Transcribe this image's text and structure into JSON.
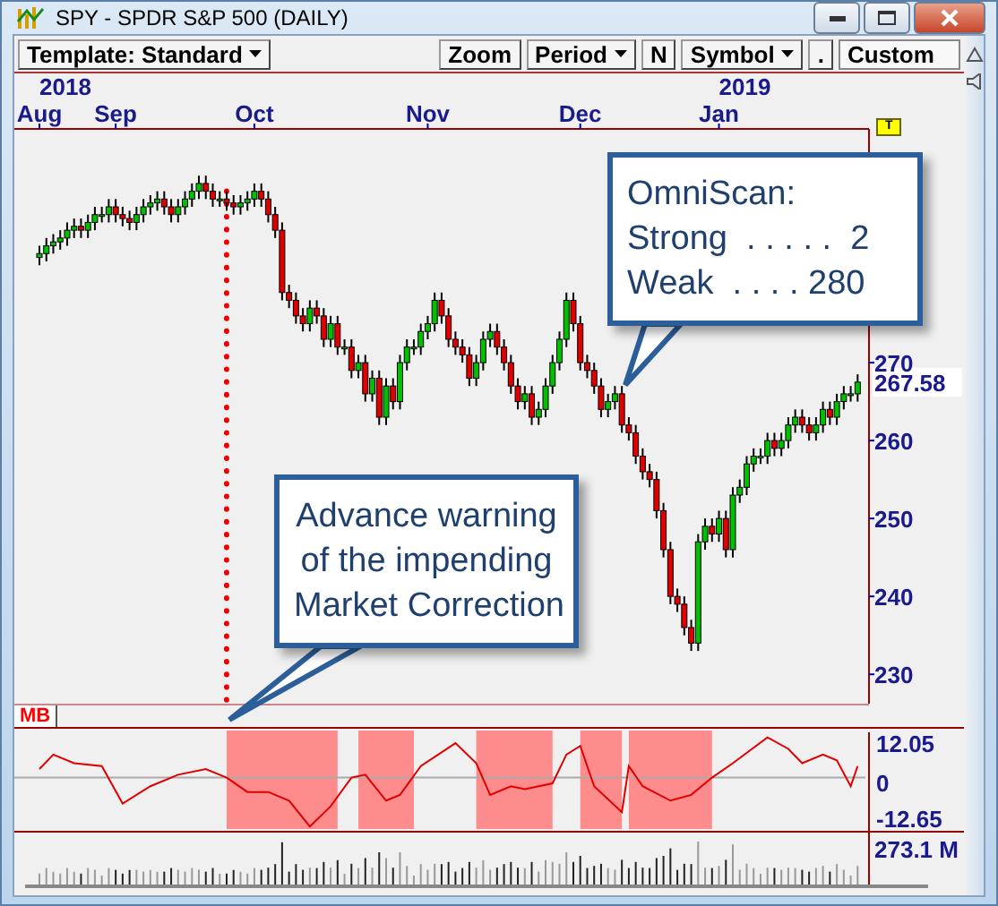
{
  "window": {
    "title": "SPY - SPDR S&P 500 (DAILY)"
  },
  "toolbar": {
    "template": "Template: Standard",
    "buttons": [
      {
        "label": "Zoom",
        "dropdown": false
      },
      {
        "label": "Period",
        "dropdown": true
      },
      {
        "label": "N",
        "dropdown": false
      },
      {
        "label": "Symbol",
        "dropdown": true
      },
      {
        "label": ".",
        "dropdown": false
      }
    ],
    "custom": "Custom"
  },
  "date_axis": {
    "years": [
      "2018",
      "2019"
    ]
  },
  "flag_label": "T",
  "price_chart": {
    "last_price": "267.58",
    "chart_data": {
      "type": "candlestick",
      "ylim": [
        226,
        300
      ],
      "yticks": [
        230,
        240,
        250,
        260,
        270
      ],
      "categories": [
        "Aug",
        null,
        null,
        null,
        null,
        null,
        null,
        null,
        null,
        null,
        null,
        "Sep",
        null,
        null,
        null,
        null,
        null,
        null,
        null,
        null,
        null,
        null,
        null,
        null,
        null,
        null,
        null,
        null,
        null,
        null,
        null,
        "Oct",
        null,
        null,
        null,
        null,
        null,
        null,
        null,
        null,
        null,
        null,
        null,
        null,
        null,
        null,
        null,
        null,
        null,
        null,
        null,
        null,
        null,
        null,
        null,
        null,
        "Nov",
        null,
        null,
        null,
        null,
        null,
        null,
        null,
        null,
        null,
        null,
        null,
        null,
        null,
        null,
        null,
        null,
        null,
        null,
        null,
        null,
        null,
        "Dec",
        null,
        null,
        null,
        null,
        null,
        null,
        null,
        null,
        null,
        null,
        null,
        null,
        null,
        null,
        null,
        null,
        null,
        null,
        null,
        "Jan",
        null,
        null,
        null,
        null,
        null,
        null,
        null,
        null,
        null,
        null,
        null,
        null,
        null,
        null,
        null,
        null,
        null,
        null,
        null,
        null
      ],
      "ohlc": [
        [
          283.5,
          285,
          282.5,
          284
        ],
        [
          284,
          286,
          283,
          285
        ],
        [
          285,
          286.5,
          284,
          285.5
        ],
        [
          285.5,
          287,
          284.5,
          286
        ],
        [
          286,
          288,
          285,
          287
        ],
        [
          287,
          288.5,
          286,
          287.5
        ],
        [
          287.5,
          288.5,
          286,
          287
        ],
        [
          287,
          289,
          286,
          288
        ],
        [
          288,
          290,
          287,
          289
        ],
        [
          289,
          290,
          288,
          289
        ],
        [
          289,
          291,
          288,
          290
        ],
        [
          290,
          291,
          288,
          289
        ],
        [
          289,
          290,
          287.5,
          288.5
        ],
        [
          288.5,
          289.5,
          287,
          288
        ],
        [
          288,
          290,
          287,
          289
        ],
        [
          289,
          291,
          288,
          290
        ],
        [
          290,
          291.5,
          289,
          290.5
        ],
        [
          290.5,
          292,
          289.5,
          291
        ],
        [
          291,
          292,
          289,
          290
        ],
        [
          290,
          291,
          288,
          289
        ],
        [
          289,
          291,
          288,
          290
        ],
        [
          290,
          292,
          289,
          291
        ],
        [
          291,
          293,
          290,
          292
        ],
        [
          292,
          294,
          291,
          293
        ],
        [
          293,
          294,
          291,
          292
        ],
        [
          292,
          293,
          290,
          291
        ],
        [
          291,
          292,
          290,
          291
        ],
        [
          291,
          292,
          289.5,
          290.5
        ],
        [
          290.5,
          291.5,
          289,
          290
        ],
        [
          290,
          291.5,
          289,
          290.5
        ],
        [
          290.5,
          292,
          289.5,
          291
        ],
        [
          291,
          293,
          290,
          292
        ],
        [
          292,
          293,
          290,
          291
        ],
        [
          291,
          292,
          288,
          289
        ],
        [
          289,
          290,
          286,
          287
        ],
        [
          287,
          288,
          278,
          279
        ],
        [
          279,
          280,
          277,
          278
        ],
        [
          278,
          279,
          275,
          276
        ],
        [
          276,
          277,
          274,
          275
        ],
        [
          275,
          278,
          274,
          277
        ],
        [
          277,
          278,
          275,
          276
        ],
        [
          276,
          277,
          272,
          273
        ],
        [
          273,
          276,
          272,
          275
        ],
        [
          275,
          276,
          271,
          272
        ],
        [
          272,
          273,
          271,
          272
        ],
        [
          272,
          273,
          268,
          269
        ],
        [
          269,
          271,
          268,
          270
        ],
        [
          270,
          271,
          265,
          266
        ],
        [
          266,
          269,
          265,
          268
        ],
        [
          268,
          269,
          262,
          263
        ],
        [
          263,
          268,
          262,
          267
        ],
        [
          267,
          268,
          264,
          265
        ],
        [
          265,
          271,
          264,
          270
        ],
        [
          270,
          273,
          269,
          272
        ],
        [
          272,
          273,
          271,
          272
        ],
        [
          272,
          275,
          271,
          274
        ],
        [
          274,
          276,
          273,
          275
        ],
        [
          275,
          279,
          274,
          278
        ],
        [
          278,
          279,
          275,
          276
        ],
        [
          276,
          277,
          272,
          273
        ],
        [
          273,
          274,
          271,
          272
        ],
        [
          272,
          273,
          270,
          271
        ],
        [
          271,
          272,
          267,
          268
        ],
        [
          268,
          271,
          267,
          270
        ],
        [
          270,
          274,
          269,
          273
        ],
        [
          273,
          275,
          272,
          274
        ],
        [
          274,
          275,
          271,
          272
        ],
        [
          272,
          273,
          269,
          270
        ],
        [
          270,
          271,
          266,
          267
        ],
        [
          267,
          268,
          264,
          265
        ],
        [
          265,
          267,
          264,
          266
        ],
        [
          266,
          267,
          262,
          263
        ],
        [
          263,
          265,
          262,
          264
        ],
        [
          264,
          268,
          263,
          267
        ],
        [
          267,
          271,
          266,
          270
        ],
        [
          270,
          274,
          269,
          273
        ],
        [
          273,
          279,
          272,
          278
        ],
        [
          278,
          279,
          274,
          275
        ],
        [
          275,
          276,
          269,
          270
        ],
        [
          270,
          271,
          268,
          269
        ],
        [
          269,
          270,
          266,
          267
        ],
        [
          267,
          268,
          263,
          264
        ],
        [
          264,
          266,
          263,
          265
        ],
        [
          265,
          267,
          264,
          266
        ],
        [
          266,
          267,
          261,
          262
        ],
        [
          262,
          263,
          260,
          261
        ],
        [
          261,
          262,
          257,
          258
        ],
        [
          258,
          259,
          255,
          256
        ],
        [
          256,
          257,
          254,
          255
        ],
        [
          255,
          256,
          250,
          251
        ],
        [
          251,
          252,
          245,
          246
        ],
        [
          246,
          247,
          239,
          240
        ],
        [
          240,
          241,
          238,
          239
        ],
        [
          239,
          240,
          235,
          236
        ],
        [
          236,
          237,
          233,
          234
        ],
        [
          234,
          248,
          233,
          247
        ],
        [
          247,
          250,
          246,
          249
        ],
        [
          249,
          250,
          247,
          248
        ],
        [
          248,
          251,
          247,
          250
        ],
        [
          250,
          251,
          245,
          246
        ],
        [
          246,
          254,
          245,
          253
        ],
        [
          253,
          255,
          252,
          254
        ],
        [
          254,
          258,
          253,
          257
        ],
        [
          257,
          259,
          256,
          258
        ],
        [
          258,
          259,
          257,
          258
        ],
        [
          258,
          261,
          257,
          260
        ],
        [
          260,
          261,
          258,
          259
        ],
        [
          259,
          261,
          258,
          260
        ],
        [
          260,
          263,
          259,
          262
        ],
        [
          262,
          264,
          261,
          263
        ],
        [
          263,
          264,
          261,
          262
        ],
        [
          262,
          263,
          260,
          261
        ],
        [
          261,
          263,
          260,
          262
        ],
        [
          262,
          265,
          261,
          264
        ],
        [
          264,
          265,
          262,
          263
        ],
        [
          263,
          266,
          262,
          265
        ],
        [
          265,
          267,
          264,
          266
        ],
        [
          266,
          267,
          265,
          266
        ],
        [
          266,
          268.5,
          265,
          267.5
        ]
      ]
    }
  },
  "callouts": [
    {
      "lines": [
        "OmniScan:",
        "Strong  . . . . .  2",
        "Weak  . . . . 280"
      ]
    },
    {
      "lines": [
        "Advance warning",
        "of the impending",
        "Market Correction"
      ]
    }
  ],
  "indicator_tab": "MB",
  "oscillator": {
    "labels": [
      "12.05",
      "0",
      "-12.65"
    ]
  },
  "volume": {
    "label": "273.1 M"
  }
}
